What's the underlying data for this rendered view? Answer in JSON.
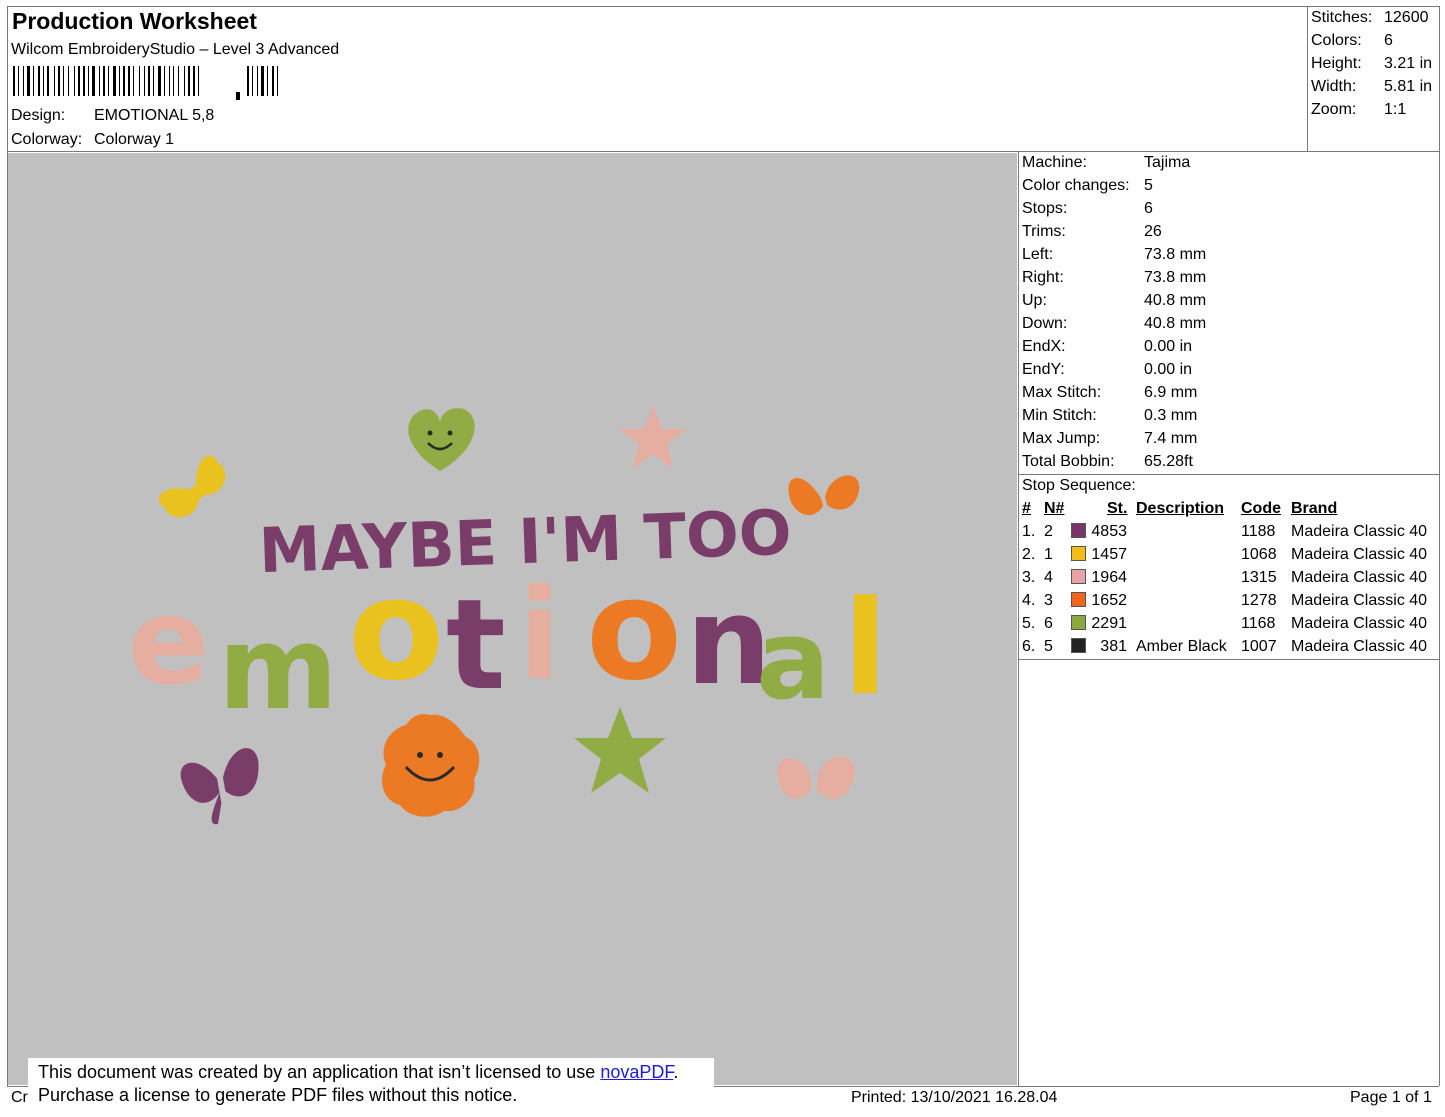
{
  "header": {
    "title": "Production Worksheet",
    "subtitle": "Wilcom EmbroideryStudio – Level 3 Advanced",
    "design_label": "Design:",
    "design_value": "EMOTIONAL 5,8",
    "colorway_label": "Colorway:",
    "colorway_value": "Colorway 1"
  },
  "summary": [
    {
      "label": "Stitches:",
      "value": "12600"
    },
    {
      "label": "Colors:",
      "value": "6"
    },
    {
      "label": "Height:",
      "value": "3.21 in"
    },
    {
      "label": "Width:",
      "value": "5.81 in"
    },
    {
      "label": "Zoom:",
      "value": "1:1"
    }
  ],
  "design_preview": {
    "line1": "MAYBE I'M TOO",
    "line2_letters": [
      "e",
      "m",
      "o",
      "t",
      "i",
      "o",
      "n",
      "a",
      "l"
    ],
    "colors": {
      "purple": "#7a3d6a",
      "yellow": "#e9c21f",
      "pink": "#e6aea0",
      "orange": "#ec7a25",
      "green": "#92ac45",
      "black": "#2a2a2a",
      "canvas": "#c0c0c0"
    }
  },
  "machine_info": [
    {
      "label": "Machine:",
      "value": "Tajima"
    },
    {
      "label": "Color changes:",
      "value": "5"
    },
    {
      "label": "Stops:",
      "value": "6"
    },
    {
      "label": "Trims:",
      "value": "26"
    },
    {
      "label": "Left:",
      "value": "73.8 mm"
    },
    {
      "label": "Right:",
      "value": "73.8 mm"
    },
    {
      "label": "Up:",
      "value": "40.8 mm"
    },
    {
      "label": "Down:",
      "value": "40.8 mm"
    },
    {
      "label": "EndX:",
      "value": "0.00 in"
    },
    {
      "label": "EndY:",
      "value": "0.00 in"
    },
    {
      "label": "Max Stitch:",
      "value": "6.9 mm"
    },
    {
      "label": "Min Stitch:",
      "value": "0.3 mm"
    },
    {
      "label": "Max Jump:",
      "value": "7.4 mm"
    },
    {
      "label": "Total Bobbin:",
      "value": "65.28ft"
    }
  ],
  "stop_sequence": {
    "heading": "Stop Sequence:",
    "columns": {
      "num": "#",
      "n": "N#",
      "st": "St.",
      "desc": "Description",
      "code": "Code",
      "brand": "Brand"
    },
    "rows": [
      {
        "num": "1.",
        "n": "2",
        "color": "#7a3568",
        "st": "4853",
        "desc": "",
        "code": "1188",
        "brand": "Madeira Classic 40"
      },
      {
        "num": "2.",
        "n": "1",
        "color": "#f6bd16",
        "st": "1457",
        "desc": "",
        "code": "1068",
        "brand": "Madeira Classic 40"
      },
      {
        "num": "3.",
        "n": "4",
        "color": "#e8a3a8",
        "st": "1964",
        "desc": "",
        "code": "1315",
        "brand": "Madeira Classic 40"
      },
      {
        "num": "4.",
        "n": "3",
        "color": "#f0651b",
        "st": "1652",
        "desc": "",
        "code": "1278",
        "brand": "Madeira Classic 40"
      },
      {
        "num": "5.",
        "n": "6",
        "color": "#8aa93d",
        "st": "2291",
        "desc": "",
        "code": "1168",
        "brand": "Madeira Classic 40"
      },
      {
        "num": "6.",
        "n": "5",
        "color": "#222222",
        "st": "381",
        "desc": "Amber Black",
        "code": "1007",
        "brand": "Madeira Classic 40"
      }
    ]
  },
  "notice": {
    "line1_prefix": "This document was created by an application that isn’t licensed to use ",
    "link": "novaPDF",
    "line1_suffix": ".",
    "line2": "Purchase a license to generate PDF files without this notice."
  },
  "footer": {
    "left_fragment": "Cr",
    "printed": "Printed: 13/10/2021 16.28.04",
    "page": "Page 1 of 1"
  }
}
